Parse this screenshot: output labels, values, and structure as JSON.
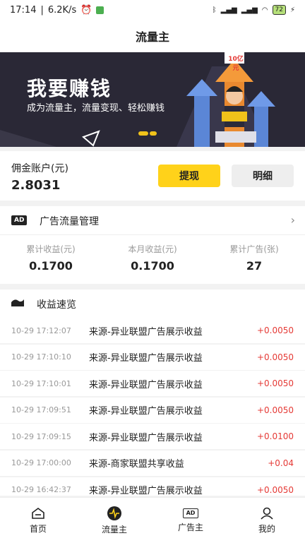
{
  "status_bar": {
    "time": "17:14",
    "speed": "6.2K/s",
    "battery": "72"
  },
  "title": "流量主",
  "banner": {
    "title": "我要赚钱",
    "subtitle": "成为流量主，流量变现、轻松赚钱",
    "tag": "10亿元"
  },
  "account": {
    "label": "佣金账户(元)",
    "value": "2.8031",
    "withdraw_label": "提现",
    "detail_label": "明细"
  },
  "ad_manage": {
    "badge": "AD",
    "title": "广告流量管理",
    "stats": [
      {
        "label": "累计收益(元)",
        "value": "0.1700"
      },
      {
        "label": "本月收益(元)",
        "value": "0.1700"
      },
      {
        "label": "累计广告(张)",
        "value": "27"
      }
    ]
  },
  "earnings": {
    "title": "收益速览",
    "rows": [
      {
        "time": "10-29 17:12:07",
        "desc": "来源-异业联盟广告展示收益",
        "amount": "+0.0050"
      },
      {
        "time": "10-29 17:10:10",
        "desc": "来源-异业联盟广告展示收益",
        "amount": "+0.0050"
      },
      {
        "time": "10-29 17:10:01",
        "desc": "来源-异业联盟广告展示收益",
        "amount": "+0.0050"
      },
      {
        "time": "10-29 17:09:51",
        "desc": "来源-异业联盟广告展示收益",
        "amount": "+0.0050"
      },
      {
        "time": "10-29 17:09:15",
        "desc": "来源-异业联盟广告展示收益",
        "amount": "+0.0100"
      },
      {
        "time": "10-29 17:00:00",
        "desc": "来源-商家联盟共享收益",
        "amount": "+0.04"
      },
      {
        "time": "10-29 16:42:37",
        "desc": "来源-异业联盟广告展示收益",
        "amount": "+0.0050"
      }
    ]
  },
  "nav": {
    "items": [
      {
        "label": "首页",
        "icon": "home-icon"
      },
      {
        "label": "流量主",
        "icon": "traffic-icon"
      },
      {
        "label": "广告主",
        "icon": "ad-icon"
      },
      {
        "label": "我的",
        "icon": "user-icon"
      }
    ],
    "ad_icon_text": "AD"
  },
  "colors": {
    "accent": "#ffd21a",
    "amount": "#e53935",
    "banner_bg": "#2a2836"
  }
}
